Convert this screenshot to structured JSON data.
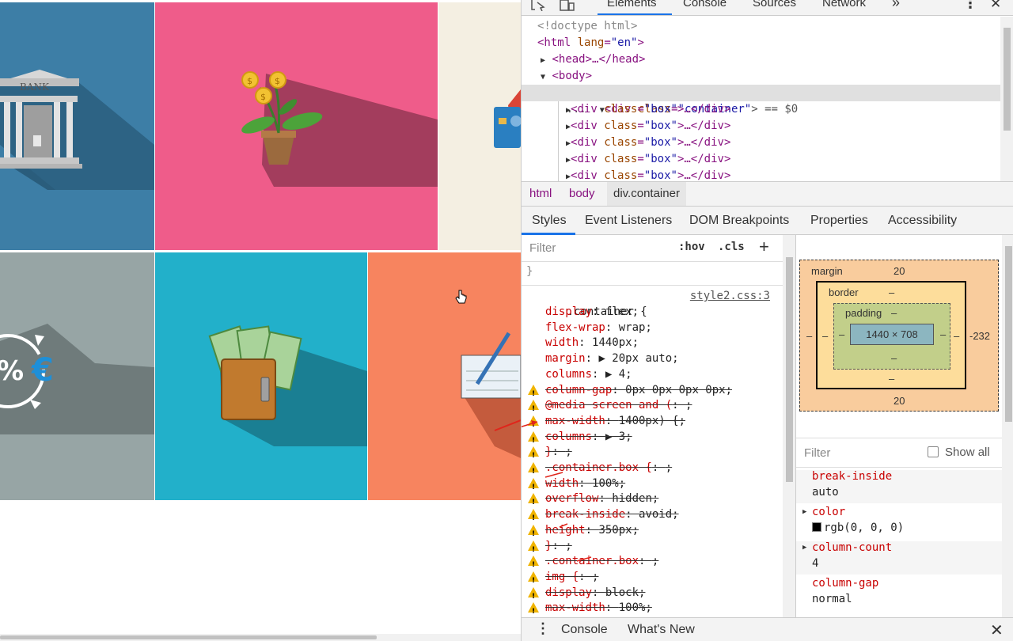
{
  "page": {
    "bank_label": "BANK",
    "percent_symbol": "%",
    "euro_symbol": "€"
  },
  "devtools": {
    "tabs": [
      "Elements",
      "Console",
      "Sources",
      "Network"
    ],
    "more_tabs": "»",
    "close": "✕",
    "dom": {
      "doctype": "<!doctype html>",
      "html_open_tag": "<html",
      "html_lang_attr": "lang",
      "html_lang_val": "\"en\"",
      "head_line": "<head>…</head>",
      "body_open": "<body>",
      "container_tag": "<div",
      "container_attr": "class",
      "container_val": "\"container\"",
      "container_suffix": "> == $0",
      "ellipsis": "...",
      "box_tag": "<div",
      "box_attr": "class",
      "box_val": "\"box\"",
      "box_suffix": ">…</div>"
    },
    "breadcrumbs": [
      "html",
      "body",
      "div.container"
    ],
    "subtabs": [
      "Styles",
      "Event Listeners",
      "DOM Breakpoints",
      "Properties",
      "Accessibility"
    ],
    "styles": {
      "filter_placeholder": "Filter",
      "hov": ":hov",
      "cls": ".cls",
      "plus": "+",
      "closing_brace": "}",
      "selector": ".container {",
      "source": "style2.css:3",
      "declarations": [
        {
          "prop": "display",
          "val": "flex;",
          "struck": false,
          "warn": false
        },
        {
          "prop": "flex-wrap",
          "val": "wrap;",
          "struck": false,
          "warn": false
        },
        {
          "prop": "width",
          "val": "1440px;",
          "struck": false,
          "warn": false
        },
        {
          "prop": "margin",
          "val": "▶ 20px auto;",
          "struck": false,
          "warn": false
        },
        {
          "prop": "columns",
          "val": "▶ 4;",
          "struck": false,
          "warn": false
        },
        {
          "prop": "column-gap",
          "val": "0px 0px 0px 0px;",
          "struck": true,
          "warn": true
        },
        {
          "prop": "@media screen and (",
          "val": ";",
          "struck": true,
          "warn": true
        },
        {
          "prop": "max-width",
          "val": "1400px) {;",
          "struck": true,
          "warn": true
        },
        {
          "prop": "columns",
          "val": "▶ 3;",
          "struck": true,
          "warn": true
        },
        {
          "prop": "}",
          "val": ";",
          "struck": true,
          "warn": true
        },
        {
          "prop": ".container.box {",
          "val": ";",
          "struck": true,
          "warn": true
        },
        {
          "prop": "width",
          "val": "100%;",
          "struck": true,
          "warn": true
        },
        {
          "prop": "overflow",
          "val": "hidden;",
          "struck": true,
          "warn": true
        },
        {
          "prop": "break-inside",
          "val": "avoid;",
          "struck": true,
          "warn": true
        },
        {
          "prop": "height",
          "val": "350px;",
          "struck": true,
          "warn": true
        },
        {
          "prop": "}",
          "val": ";",
          "struck": true,
          "warn": true
        },
        {
          "prop": ".container.box",
          "val": ";",
          "struck": true,
          "warn": true
        },
        {
          "prop": "img {",
          "val": ";",
          "struck": true,
          "warn": true
        },
        {
          "prop": "display",
          "val": "block;",
          "struck": true,
          "warn": true
        },
        {
          "prop": "max-width",
          "val": "100%;",
          "struck": true,
          "warn": true
        }
      ]
    },
    "box_model": {
      "margin_label": "margin",
      "margin_top": "20",
      "margin_bottom": "20",
      "margin_left": "–",
      "margin_right": "-232",
      "border_label": "border",
      "border_value": "–",
      "border_bottom": "–",
      "border_left": "–",
      "border_right": "–",
      "padding_label": "padding",
      "padding_value": "–",
      "padding_bottom": "–",
      "padding_left": "–",
      "padding_right": "–",
      "content_size": "1440 × 708"
    },
    "computed": {
      "filter_placeholder": "Filter",
      "show_all": "Show all",
      "show_all_checked": false,
      "properties": [
        {
          "name": "break-inside",
          "value": "auto",
          "expandable": false
        },
        {
          "name": "color",
          "value": "rgb(0, 0, 0)",
          "expandable": true
        },
        {
          "name": "column-count",
          "value": "4",
          "expandable": true
        },
        {
          "name": "column-gap",
          "value": "normal",
          "expandable": false
        }
      ]
    },
    "drawer": {
      "tabs": [
        "Console",
        "What's New"
      ],
      "close": "✕"
    }
  },
  "colors": {
    "tile_blue": "#3d7ea6",
    "tile_pink": "#ef5c8a",
    "tile_cream": "#f4efe2",
    "tile_gray": "#97a5a5",
    "tile_cyan": "#22b0ca",
    "tile_orange": "#f7845f",
    "accent": "#1a73e8"
  }
}
